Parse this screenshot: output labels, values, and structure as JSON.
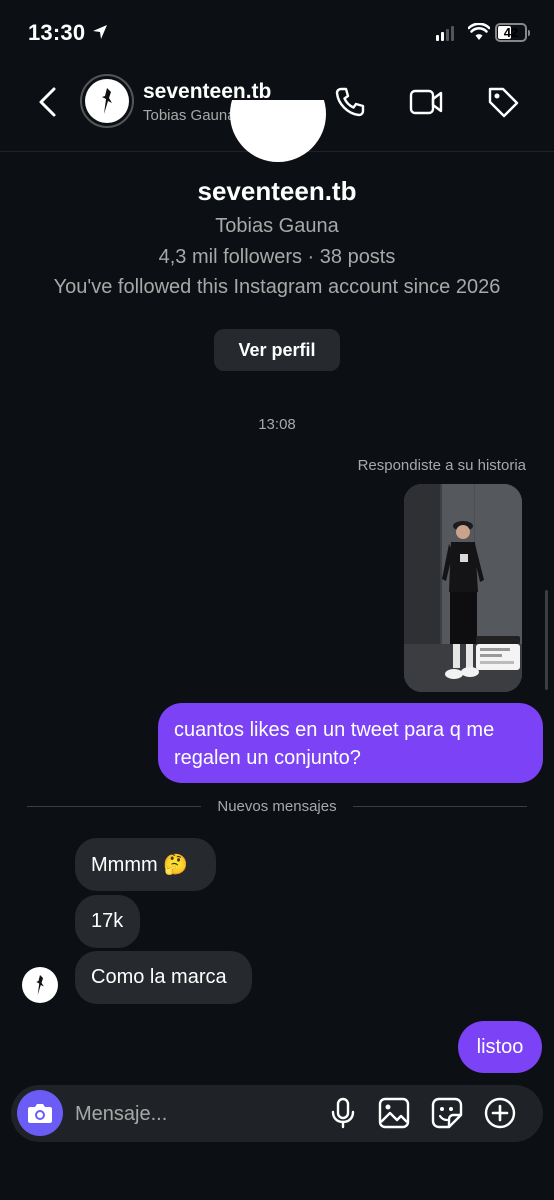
{
  "status_bar": {
    "time": "13:30",
    "battery": "42"
  },
  "header": {
    "username": "seventeen.tb",
    "full_name": "Tobias Gauna"
  },
  "profile": {
    "username": "seventeen.tb",
    "full_name": "Tobias Gauna",
    "stats": "4,3 mil followers · 38 posts",
    "since": "You've followed this Instagram account since 2026",
    "view_button": "Ver perfil"
  },
  "thread": {
    "timestamp": "13:08",
    "story_reply_label": "Respondiste a su historia",
    "outgoing_1": "cuantos likes en un tweet para q me regalen un conjunto?",
    "divider": "Nuevos mensajes",
    "incoming": [
      "Mmmm 🤔",
      "17k",
      "Como la marca"
    ],
    "outgoing_2": "listoo"
  },
  "composer": {
    "placeholder": "Mensaje..."
  },
  "colors": {
    "background": "#0c1014",
    "bubble_out": "#7b42f6",
    "bubble_in": "#262a2e",
    "camera": "#6b5cf5"
  },
  "icons": [
    "location-arrow-icon",
    "signal-icon",
    "wifi-icon",
    "battery-icon",
    "back-chevron-icon",
    "phone-icon",
    "video-camera-icon",
    "tag-icon",
    "camera-icon",
    "microphone-icon",
    "image-icon",
    "sticker-icon",
    "plus-circle-icon"
  ]
}
